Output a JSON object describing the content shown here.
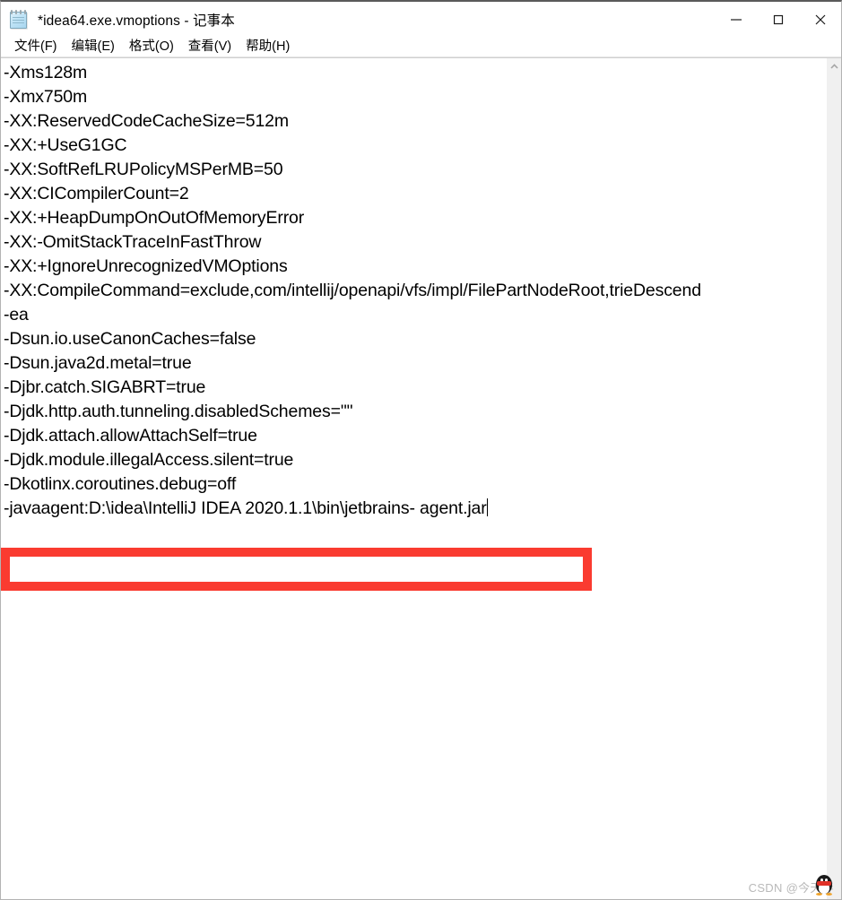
{
  "window": {
    "title": "*idea64.exe.vmoptions - 记事本",
    "icon": "notepad-icon",
    "controls": {
      "minimize": "minimize-button",
      "maximize": "maximize-button",
      "close": "close-button"
    }
  },
  "menu": {
    "items": [
      {
        "label": "文件(F)"
      },
      {
        "label": "编辑(E)"
      },
      {
        "label": "格式(O)"
      },
      {
        "label": "查看(V)"
      },
      {
        "label": "帮助(H)"
      }
    ]
  },
  "editor": {
    "lines": [
      "-Xms128m",
      "-Xmx750m",
      "-XX:ReservedCodeCacheSize=512m",
      "-XX:+UseG1GC",
      "-XX:SoftRefLRUPolicyMSPerMB=50",
      "-XX:CICompilerCount=2",
      "-XX:+HeapDumpOnOutOfMemoryError",
      "-XX:-OmitStackTraceInFastThrow",
      "-XX:+IgnoreUnrecognizedVMOptions",
      "-XX:CompileCommand=exclude,com/intellij/openapi/vfs/impl/FilePartNodeRoot,trieDescend",
      "-ea",
      "-Dsun.io.useCanonCaches=false",
      "-Dsun.java2d.metal=true",
      "-Djbr.catch.SIGABRT=true",
      "-Djdk.http.auth.tunneling.disabledSchemes=\"\"",
      "-Djdk.attach.allowAttachSelf=true",
      "-Djdk.module.illegalAccess.silent=true",
      "-Dkotlinx.coroutines.debug=off"
    ],
    "highlighted_line": "-javaagent:D:\\idea\\IntelliJ IDEA 2020.1.1\\bin\\jetbrains- agent.jar",
    "caret_after_highlighted_line": true,
    "annotation_color": "#fa3b30"
  },
  "scrollbar": {
    "up_arrow": "chevron-up-icon",
    "down_arrow": "chevron-down-icon"
  },
  "watermark": {
    "text": "CSDN @今天胖",
    "icon": "qq-penguin-icon"
  }
}
